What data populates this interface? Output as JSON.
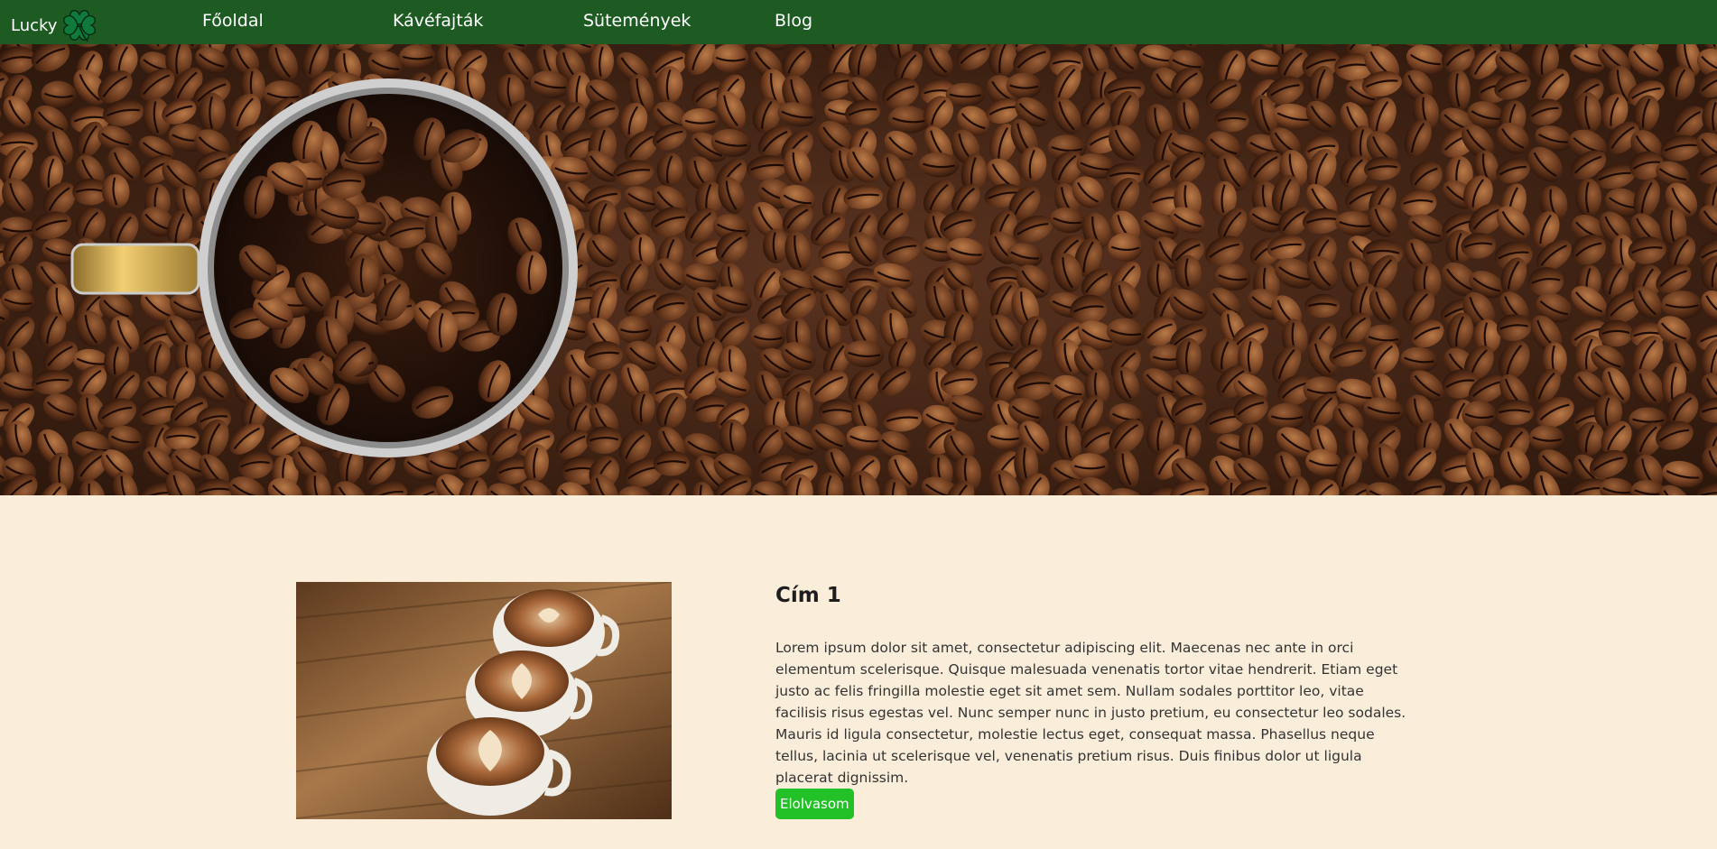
{
  "nav": {
    "brand": "Lucky",
    "items": [
      {
        "label": "Főoldal"
      },
      {
        "label": "Kávéfajták"
      },
      {
        "label": "Sütemények"
      },
      {
        "label": "Blog"
      }
    ]
  },
  "article": {
    "title": "Cím 1",
    "body": "Lorem ipsum dolor sit amet, consectetur adipiscing elit. Maecenas nec ante in orci elementum scelerisque. Quisque malesuada venenatis tortor vitae hendrerit. Etiam eget justo ac felis fringilla molestie eget sit amet sem. Nullam sodales porttitor leo, vitae facilisis risus egestas vel. Nunc semper nunc in justo pretium, eu consectetur leo sodales. Mauris id ligula consectetur, molestie lectus eget, consequat massa. Phasellus neque tellus, lacinia ut scelerisque vel, venenatis pretium risus. Duis finibus dolor ut ligula placerat dignissim.",
    "button_label": "Elolvasom"
  },
  "colors": {
    "navbar": "#1e5b22",
    "page_background": "#faeedb",
    "button": "#22c127",
    "clover": "#0f7a3c"
  },
  "icons": {
    "brand_icon": "four-leaf-clover-icon"
  }
}
